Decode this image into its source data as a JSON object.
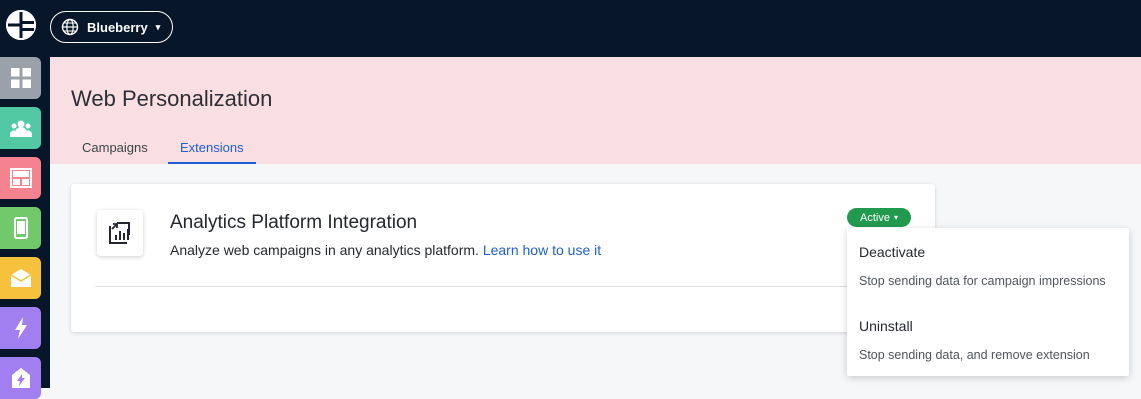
{
  "topbar": {
    "logo_icon": "brand-logo-icon",
    "workspace_label": "Blueberry",
    "workspace_icon": "globe-icon",
    "caret": "▾"
  },
  "sidebar": {
    "items": [
      {
        "name": "dashboard",
        "icon": "grid-icon",
        "color": "#9aa1ab"
      },
      {
        "name": "audience",
        "icon": "people-icon",
        "color": "#52c9a2"
      },
      {
        "name": "web",
        "icon": "layout-icon",
        "color": "#f4828f"
      },
      {
        "name": "mobile",
        "icon": "phone-icon",
        "color": "#72c96b"
      },
      {
        "name": "email",
        "icon": "envelope-icon",
        "color": "#f6c23e"
      },
      {
        "name": "journeys",
        "icon": "lightning-icon",
        "color": "#a17ff0"
      },
      {
        "name": "push",
        "icon": "bolt-tag-icon",
        "color": "#a17ff0"
      }
    ]
  },
  "header": {
    "title": "Web Personalization",
    "tabs": [
      {
        "label": "Campaigns",
        "active": false
      },
      {
        "label": "Extensions",
        "active": true
      }
    ]
  },
  "extension": {
    "icon": "analytics-chart-icon",
    "title": "Analytics Platform Integration",
    "description": "Analyze web campaigns in any analytics platform.",
    "link_text": "Learn how to use it",
    "status": "Active",
    "status_color": "#229a4e"
  },
  "menu": {
    "items": [
      {
        "label": "Deactivate",
        "description": "Stop sending data for campaign impressions"
      },
      {
        "label": "Uninstall",
        "description": "Stop sending data, and remove extension"
      }
    ]
  },
  "colors": {
    "nav_bg": "#071629",
    "header_bg": "#f9dfe1",
    "accent": "#1f5fd1"
  }
}
